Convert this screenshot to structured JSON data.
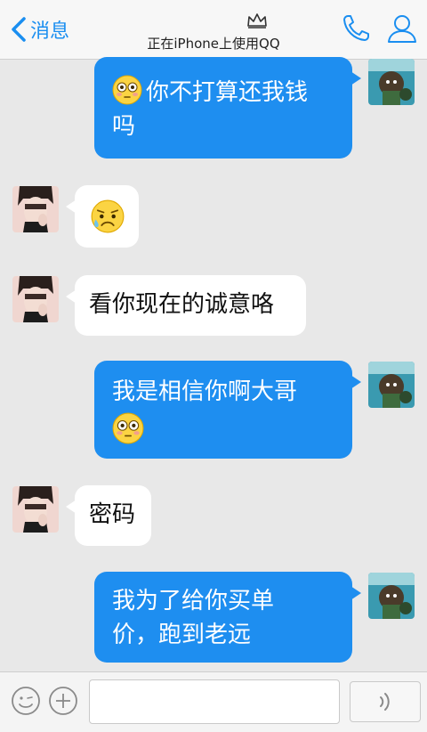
{
  "header": {
    "back_label": "消息",
    "status_text": "正在iPhone上使用QQ",
    "icons": [
      "chevron-left-icon",
      "crown-icon",
      "phone-icon",
      "user-profile-icon"
    ],
    "accent_color": "#1a8ef0"
  },
  "messages": [
    {
      "direction": "sent",
      "emoji": "flushed-face",
      "text_line1": "你不打算还我钱",
      "text_line2": "吗"
    },
    {
      "direction": "received",
      "emoji": "sad-sweat-face",
      "text": ""
    },
    {
      "direction": "received",
      "text": "看你现在的诚意咯"
    },
    {
      "direction": "sent",
      "emoji": "flushed-face",
      "text": "我是相信你啊大哥"
    },
    {
      "direction": "received",
      "text": "密码"
    },
    {
      "direction": "sent",
      "text_line1": "我为了给你买单",
      "text_line2": "价，跑到老远"
    }
  ],
  "colors": {
    "sent_bubble": "#1e8ef0",
    "received_bubble": "#ffffff",
    "background": "#e8e8e8"
  },
  "input_bar": {
    "icons": [
      "emoji-icon",
      "plus-icon",
      "voice-icon"
    ],
    "text_value": ""
  }
}
